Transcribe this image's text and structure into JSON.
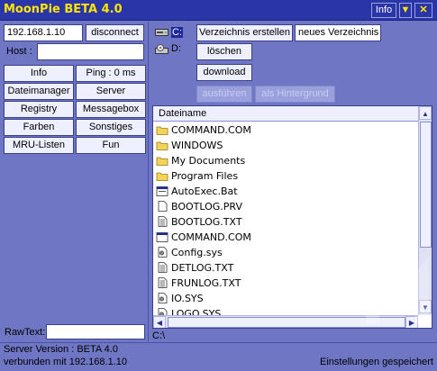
{
  "window": {
    "title": "MoonPie BETA 4.0",
    "info_label": "Info",
    "minimize_glyph": "▼",
    "close_glyph": "✕"
  },
  "connection": {
    "ip_value": "192.168.1.10",
    "disconnect_label": "disconnect",
    "host_label": "Host :",
    "host_value": ""
  },
  "nav": {
    "info": "Info",
    "ping": "Ping : 0 ms",
    "dateimanager": "Dateimanager",
    "server": "Server",
    "registry": "Registry",
    "messagebox": "Messagebox",
    "farben": "Farben",
    "sonstiges": "Sonstiges",
    "mru_listen": "MRU-Listen",
    "fun": "Fun"
  },
  "rawtext": {
    "label": "RawText:",
    "value": ""
  },
  "drives": [
    {
      "label": "C:",
      "icon": "network-drive-icon",
      "selected": true
    },
    {
      "label": "D:",
      "icon": "cd-drive-icon",
      "selected": false
    }
  ],
  "file_actions": {
    "create_dir": "Verzeichnis erstellen",
    "new_dir_name": "neues Verzeichnis",
    "delete": "löschen",
    "download": "download",
    "execute": "ausführen",
    "background": "als Hintergrund"
  },
  "filelist": {
    "header": "Dateiname",
    "rows": [
      {
        "name": "COMMAND.COM",
        "icon": "folder-icon"
      },
      {
        "name": "WINDOWS",
        "icon": "folder-icon"
      },
      {
        "name": "My Documents",
        "icon": "folder-icon"
      },
      {
        "name": "Program Files",
        "icon": "folder-icon"
      },
      {
        "name": "AutoExec.Bat",
        "icon": "batch-file-icon"
      },
      {
        "name": "BOOTLOG.PRV",
        "icon": "file-icon"
      },
      {
        "name": "BOOTLOG.TXT",
        "icon": "text-file-icon"
      },
      {
        "name": "COMMAND.COM",
        "icon": "app-file-icon"
      },
      {
        "name": "Config.sys",
        "icon": "system-file-icon"
      },
      {
        "name": "DETLOG.TXT",
        "icon": "text-file-icon"
      },
      {
        "name": "FRUNLOG.TXT",
        "icon": "text-file-icon"
      },
      {
        "name": "IO.SYS",
        "icon": "system-file-icon"
      },
      {
        "name": "LOGO.SYS",
        "icon": "system-file-icon"
      }
    ]
  },
  "path": "C:\\",
  "status": {
    "server_version": "Server Version : BETA 4.0",
    "connected": "verbunden mit 192.168.1.10",
    "settings_saved": "Einstellungen gespeichert"
  },
  "colors": {
    "background": "#6f76c4",
    "titlebar": "#2a36a8",
    "title_text": "#ffe400",
    "selection": "#1f2a9a",
    "folder": "#f5d35a"
  }
}
